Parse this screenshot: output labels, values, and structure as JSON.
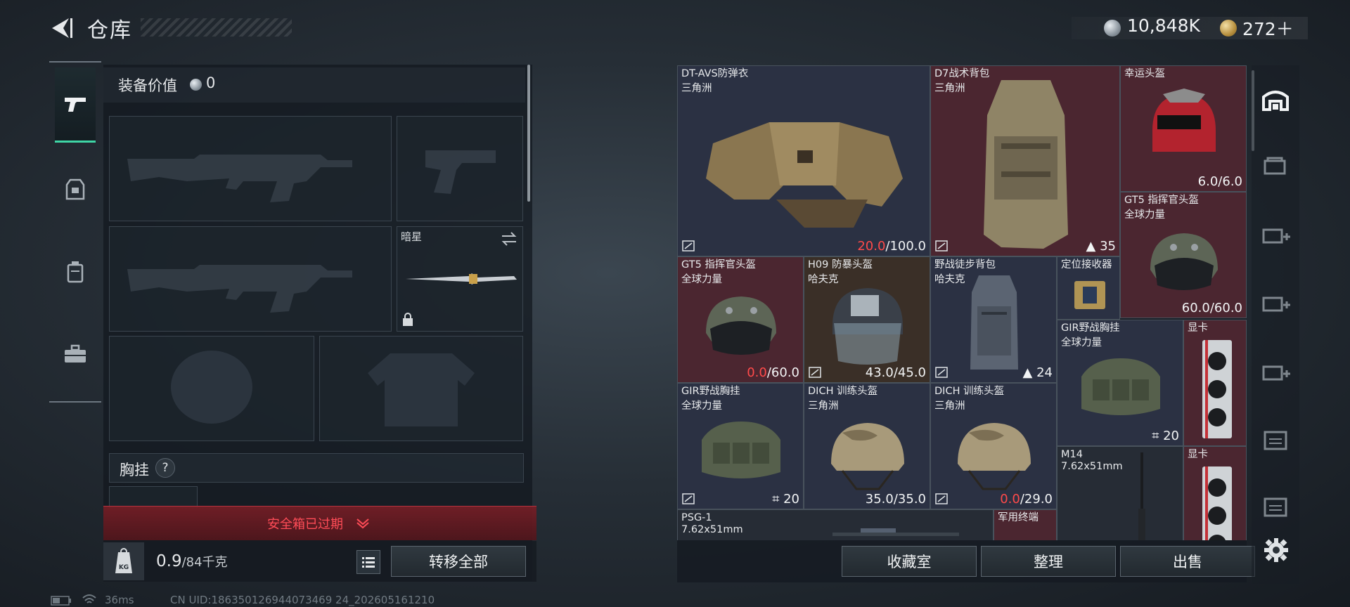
{
  "header": {
    "title": "仓库"
  },
  "currency": {
    "coins": "10,848K",
    "tokens": "272＋"
  },
  "equipment": {
    "value_label": "装备价值",
    "value": "0",
    "melee_name": "暗星",
    "section_label": "胸挂",
    "help": "?",
    "safebox_status": "安全箱已过期",
    "weight_current": "0.9",
    "weight_max": "/84千克",
    "weight_icon_text": "KG",
    "transfer_all_label": "转移全部"
  },
  "stash": {
    "items": [
      {
        "name": "DT-AVS防弹衣",
        "sub": "三角洲",
        "dur_cur": "20.0",
        "dur_max": "/100.0",
        "cur_red": true
      },
      {
        "name": "D7战术背包",
        "sub": "三角洲",
        "count": "35"
      },
      {
        "name": "幸运头盔",
        "sub": "",
        "dur_cur": "6.0",
        "dur_max": "/6.0"
      },
      {
        "name": "GT5 指挥官头盔",
        "sub": "全球力量",
        "dur_cur": "60.0",
        "dur_max": "/60.0"
      },
      {
        "name": "GT5 指挥官头盔",
        "sub": "全球力量",
        "dur_cur": "0.0",
        "dur_max": "/60.0",
        "cur_red": true
      },
      {
        "name": "H09 防暴头盔",
        "sub": "哈夫克",
        "dur_cur": "43.0",
        "dur_max": "/45.0"
      },
      {
        "name": "野战徒步背包",
        "sub": "哈夫克",
        "count": "24"
      },
      {
        "name": "定位接收器",
        "sub": ""
      },
      {
        "name": "GIR野战胸挂",
        "sub": "全球力量",
        "count": "20"
      },
      {
        "name": "显卡",
        "sub": ""
      },
      {
        "name": "GIR野战胸挂",
        "sub": "全球力量",
        "count": "20"
      },
      {
        "name": "DICH 训练头盔",
        "sub": "三角洲",
        "dur_cur": "35.0",
        "dur_max": "/35.0"
      },
      {
        "name": "DICH 训练头盔",
        "sub": "三角洲",
        "dur_cur": "0.0",
        "dur_max": "/29.0",
        "cur_red": true
      },
      {
        "name": "M14",
        "sub": "7.62x51mm"
      },
      {
        "name": "显卡",
        "sub": ""
      },
      {
        "name": "PSG-1",
        "sub": "7.62x51mm"
      },
      {
        "name": "军用终端",
        "sub": ""
      }
    ],
    "buttons": {
      "collection": "收藏室",
      "sort": "整理",
      "sell": "出售"
    }
  },
  "status_bar": {
    "ping": "36ms",
    "uid": "CN UID:186350126944073469 24_202605161210"
  },
  "icons": [
    "back-arrow-icon",
    "silver-coin-icon",
    "gold-coin-icon",
    "pistol-icon",
    "armor-icon",
    "backpack-icon",
    "toolbox-icon",
    "swap-icon",
    "lock-icon",
    "chevron-down-icon",
    "weight-icon",
    "list-icon",
    "wifi-icon",
    "battery-icon",
    "home-icon",
    "gear-icon"
  ],
  "colors": {
    "accent_green": "#3fd6a6",
    "danger_red": "#ff4a4a",
    "cell_red": "#4b2630",
    "cell_blue": "#2b3143"
  }
}
